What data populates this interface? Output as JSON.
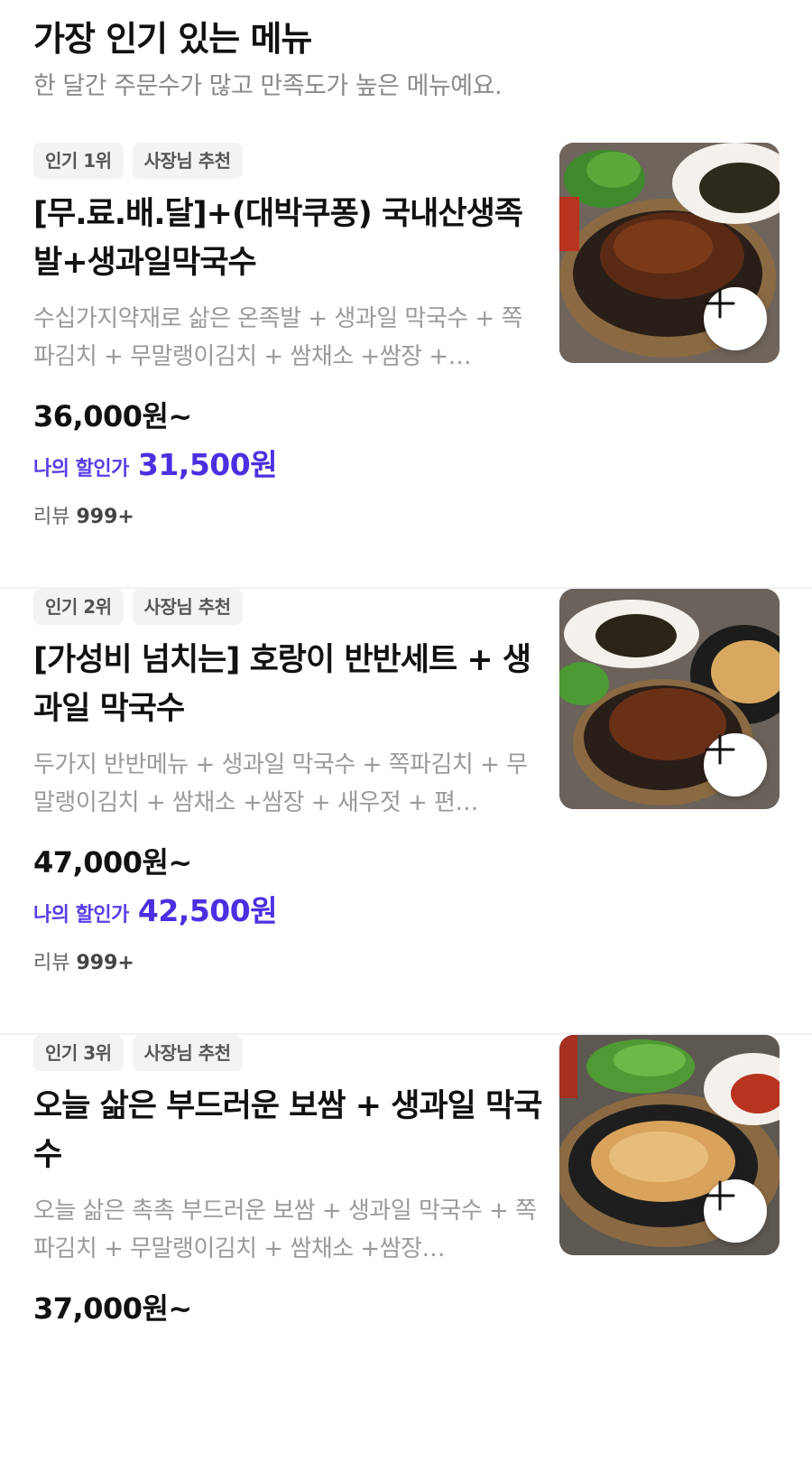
{
  "header": {
    "title": "가장 인기 있는 메뉴",
    "subtitle": "한 달간 주문수가 많고 만족도가 높은 메뉴예요."
  },
  "items": [
    {
      "badges": [
        "인기 1위",
        "사장님 추천"
      ],
      "title": "[무.료.배.달]+(대박쿠퐁) 국내산생족발+생과일막국수",
      "description": "수십가지약재로 삶은 온족발 + 생과일 막국수 + 쪽파김치 + 무말랭이김치 + 쌈채소 +쌈장 +…",
      "price": "36,000원~",
      "discount_label": "나의 할인가",
      "discount_price": "31,500원",
      "review_label": "리뷰",
      "review_count": "999+",
      "image_icon": "jokbal-photo"
    },
    {
      "badges": [
        "인기 2위",
        "사장님 추천"
      ],
      "title": "[가성비 넘치는] 호랑이 반반세트 + 생과일 막국수",
      "description": "두가지 반반메뉴 + 생과일 막국수 + 쪽파김치 + 무말랭이김치 + 쌈채소 +쌈장 + 새우젓 + 편…",
      "price": "47,000원~",
      "discount_label": "나의 할인가",
      "discount_price": "42,500원",
      "review_label": "리뷰",
      "review_count": "999+",
      "image_icon": "banban-set-photo"
    },
    {
      "badges": [
        "인기 3위",
        "사장님 추천"
      ],
      "title": "오늘 삶은 부드러운 보쌈 + 생과일 막국수",
      "description": "오늘 삶은 촉촉 부드러운 보쌈 + 생과일 막국수 + 쪽파김치 + 무말랭이김치 + 쌈채소 +쌈장…",
      "price": "37,000원~",
      "image_icon": "bossam-photo"
    }
  ],
  "add_button_icon": "plus-icon",
  "colors": {
    "accent": "#4b2fe0",
    "badge_bg": "#f2f3f5",
    "muted_text": "#9a9a9a"
  }
}
